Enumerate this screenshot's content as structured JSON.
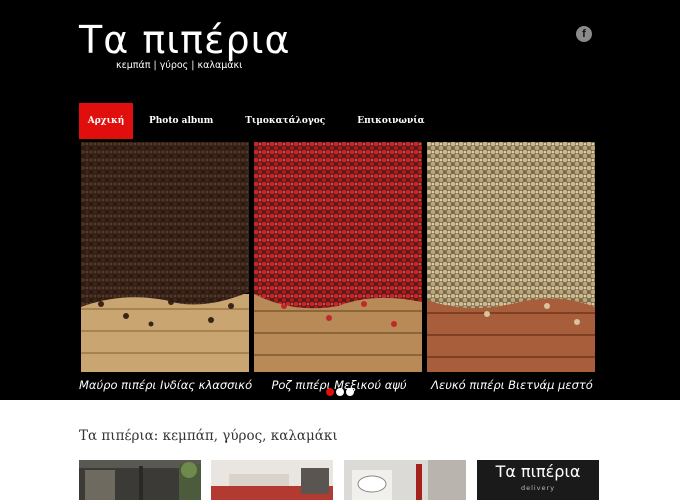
{
  "brand": {
    "title": "Τα πιπέρια",
    "tagline": "κεμπάπ | γύρος | καλαμάκι"
  },
  "social": {
    "facebook_label": "f",
    "icon": "facebook-icon"
  },
  "nav": {
    "items": [
      {
        "label": "Αρχική",
        "active": true
      },
      {
        "label": "Photo album",
        "active": false
      },
      {
        "label": "Τιμοκατάλογος",
        "active": false
      },
      {
        "label": "Επικοινωνία",
        "active": false
      }
    ]
  },
  "slider": {
    "captions": [
      "Μαύρο πιπέρι Ινδίας κλασσικό",
      "Ροζ πιπέρι Μεξικού αψύ",
      "Λευκό πιπέρι Βιετνάμ μεστό"
    ],
    "active_dot": 0,
    "dot_count": 3
  },
  "main": {
    "section_title": "Τα πιπέρια: κεμπάπ, γύρος, καλαμάκι"
  },
  "delivery_banner": {
    "title": "Τα πιπέρια",
    "subtitle": "delivery"
  },
  "colors": {
    "accent": "#e10e0e",
    "header_bg": "#000000",
    "page_bg": "#ffffff"
  }
}
